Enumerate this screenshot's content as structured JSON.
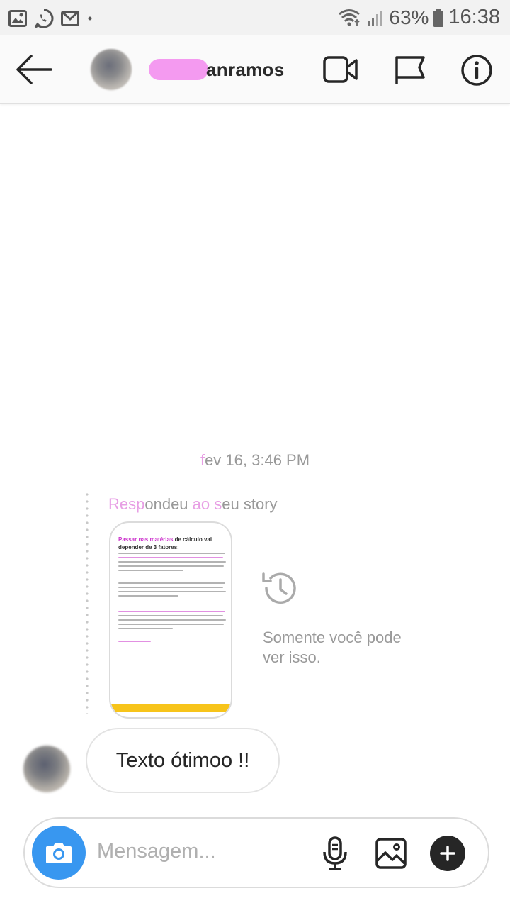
{
  "status_bar": {
    "icons": [
      "gallery-icon",
      "whatsapp-icon",
      "gmail-icon",
      "dot-icon",
      "wifi-icon",
      "signal-icon",
      "battery-icon"
    ],
    "battery": "63%",
    "time": "16:38"
  },
  "header": {
    "username_visible": "anramos",
    "icons": [
      "back-arrow-icon",
      "video-call-icon",
      "flag-icon",
      "info-icon"
    ]
  },
  "chat": {
    "timestamp_first": "f",
    "timestamp_rest": "ev 16, 3:46 PM",
    "story_reply": {
      "caption_part1": "Resp",
      "caption_part2": "ondeu ",
      "caption_part3": "ao",
      "caption_part4": " s",
      "caption_part5": "eu story",
      "story_title_pink": "Passar nas matérias",
      "story_title_rest": " de cálculo vai depender de 3 fatores:",
      "only_you_text": "Somente você pode ver isso."
    },
    "message": {
      "text": "Texto ótimoo !!"
    }
  },
  "composer": {
    "placeholder": "Mensagem...",
    "icons": [
      "camera-icon",
      "microphone-icon",
      "gallery-icon",
      "plus-icon"
    ]
  },
  "colors": {
    "accent_blue": "#3897f0",
    "redaction_pink": "#f49af0",
    "story_bar_yellow": "#f7c41a"
  }
}
